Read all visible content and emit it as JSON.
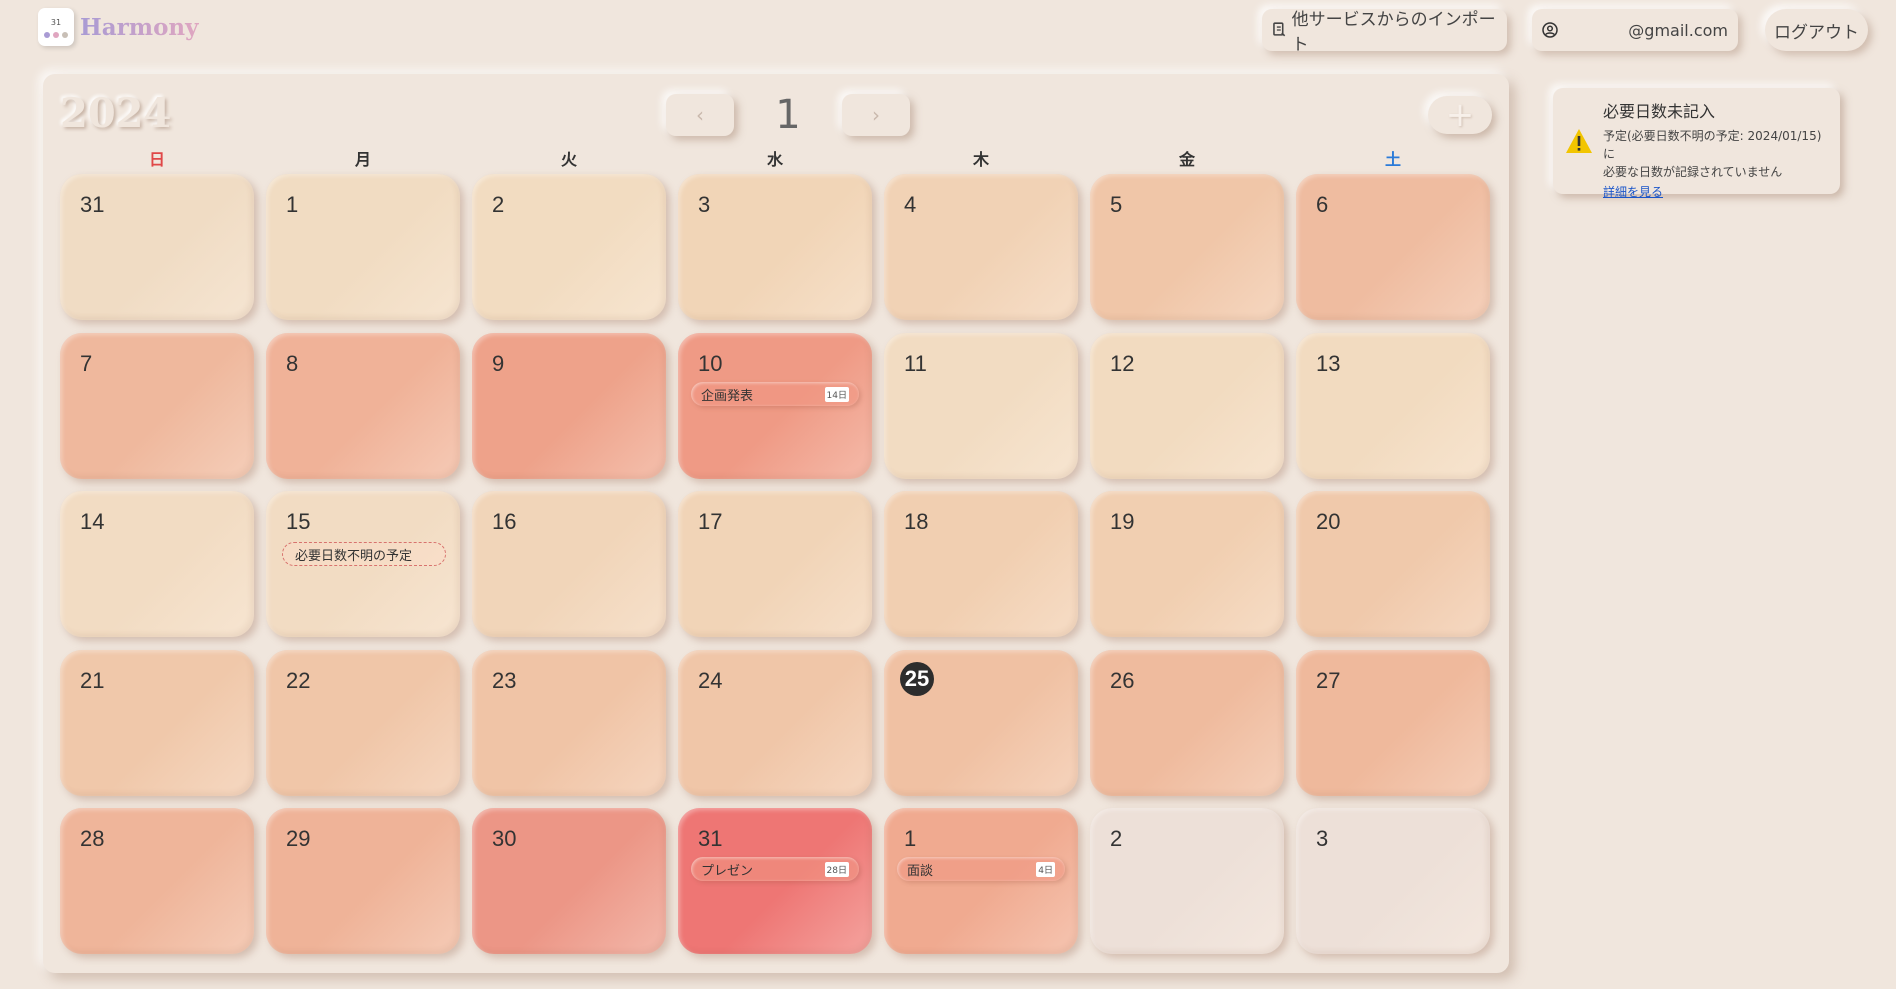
{
  "app": {
    "name": "Harmony",
    "logo_day": "31"
  },
  "header": {
    "import_label": "他サービスからのインポート",
    "account_email": "@gmail.com",
    "logout_label": "ログアウト"
  },
  "calendar": {
    "year": "2024",
    "month": "1",
    "prev_label": "‹",
    "next_label": "›",
    "add_label": "+",
    "weekdays": [
      {
        "label": "日",
        "color": "#e04848"
      },
      {
        "label": "月",
        "color": "#333333"
      },
      {
        "label": "火",
        "color": "#333333"
      },
      {
        "label": "水",
        "color": "#333333"
      },
      {
        "label": "木",
        "color": "#333333"
      },
      {
        "label": "金",
        "color": "#333333"
      },
      {
        "label": "土",
        "color": "#2b7bd8"
      }
    ],
    "days": [
      {
        "day": "31",
        "bg": "#f0dcc4",
        "outside": true
      },
      {
        "day": "1",
        "bg": "#f1dcc2"
      },
      {
        "day": "2",
        "bg": "#f2dcc1"
      },
      {
        "day": "3",
        "bg": "#f1d5b7"
      },
      {
        "day": "4",
        "bg": "#f1d2b5"
      },
      {
        "day": "5",
        "bg": "#f0c6a8"
      },
      {
        "day": "6",
        "bg": "#efbca0"
      },
      {
        "day": "7",
        "bg": "#efb89d"
      },
      {
        "day": "8",
        "bg": "#f0b298"
      },
      {
        "day": "9",
        "bg": "#ee a28a"
      },
      {
        "day": "10",
        "bg": "#ef9a85",
        "events": [
          {
            "title": "企画発表",
            "duration": "14日"
          }
        ]
      },
      {
        "day": "11",
        "bg": "#f2dcc2"
      },
      {
        "day": "12",
        "bg": "#f2dbc0"
      },
      {
        "day": "13",
        "bg": "#f2dbc0"
      },
      {
        "day": "14",
        "bg": "#f2dcc3"
      },
      {
        "day": "15",
        "bg": "#f2dcc3",
        "unknown": [
          "必要日数不明の予定"
        ]
      },
      {
        "day": "16",
        "bg": "#f1d5b9"
      },
      {
        "day": "17",
        "bg": "#f1d4b7"
      },
      {
        "day": "18",
        "bg": "#f1cfb1"
      },
      {
        "day": "19",
        "bg": "#f1cfb1"
      },
      {
        "day": "20",
        "bg": "#f0c9ab"
      },
      {
        "day": "21",
        "bg": "#f0c8aa"
      },
      {
        "day": "22",
        "bg": "#f0c6a8"
      },
      {
        "day": "23",
        "bg": "#f0c4a6"
      },
      {
        "day": "24",
        "bg": "#f0c6a8"
      },
      {
        "day": "25",
        "bg": "#f0c1a3",
        "today": true
      },
      {
        "day": "26",
        "bg": "#efbb9e"
      },
      {
        "day": "27",
        "bg": "#efb99c"
      },
      {
        "day": "28",
        "bg": "#efb59a"
      },
      {
        "day": "29",
        "bg": "#efb398"
      },
      {
        "day": "30",
        "bg": "#ec9686"
      },
      {
        "day": "31",
        "bg": "#ee7674",
        "events": [
          {
            "title": "プレゼン",
            "duration": "28日"
          }
        ]
      },
      {
        "day": "1",
        "bg": "#f0aa90",
        "outside": true,
        "events": [
          {
            "title": "面談",
            "duration": "4日"
          }
        ]
      },
      {
        "day": "2",
        "bg": "#ede0d8",
        "outside": true
      },
      {
        "day": "3",
        "bg": "#ede0d8",
        "outside": true
      }
    ]
  },
  "notice": {
    "title": "必要日数未記入",
    "line1": "予定(必要日数不明の予定: 2024/01/15)に",
    "line2": "必要な日数が記録されていません",
    "link": "詳細を見る"
  }
}
